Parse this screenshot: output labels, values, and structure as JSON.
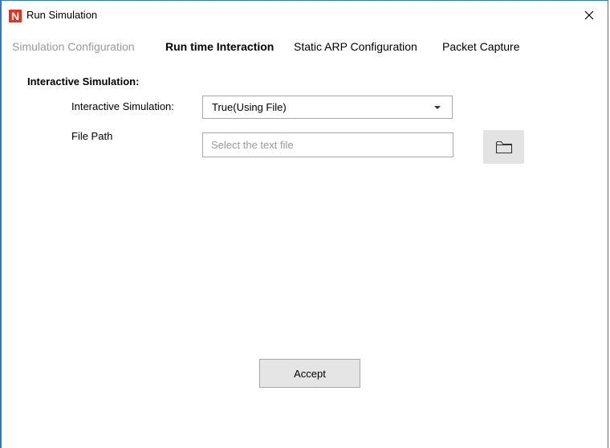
{
  "window": {
    "title": "Run Simulation",
    "app_icon": "netsim-logo-icon",
    "close_icon": "close-icon",
    "border_color": "#2b78d4"
  },
  "tabs": [
    {
      "label": "Simulation Configuration",
      "state": "disabled"
    },
    {
      "label": "Run time Interaction",
      "state": "active"
    },
    {
      "label": "Static ARP Configuration",
      "state": "normal"
    },
    {
      "label": "Packet Capture",
      "state": "normal"
    }
  ],
  "interactive_section": {
    "title": "Interactive Simulation:",
    "mode_label": "Interactive Simulation:",
    "mode_value": "True(Using File)",
    "file_path_label": "File Path",
    "file_path_value": "",
    "file_path_placeholder": "Select the text file",
    "browse_icon": "folder-icon"
  },
  "footer": {
    "accept_label": "Accept"
  }
}
